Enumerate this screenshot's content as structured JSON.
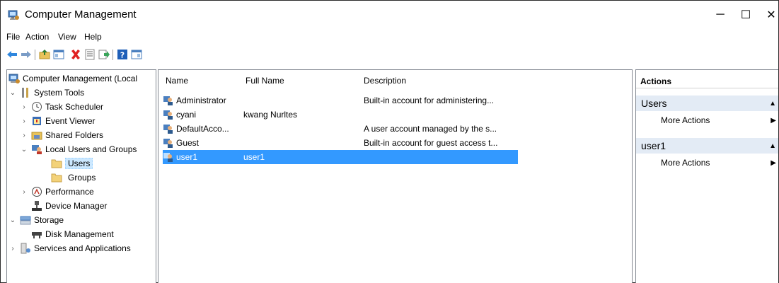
{
  "window": {
    "title": "Computer Management",
    "controls": {
      "minimize": "─",
      "maximize": "☐",
      "close": "✕"
    }
  },
  "menu": [
    "File",
    "Action",
    "View",
    "Help"
  ],
  "toolbar": {
    "buttons": [
      "back-arrow-icon",
      "forward-arrow-icon",
      "up-folder-icon",
      "show-hide-tree-icon",
      "delete-icon",
      "properties-icon",
      "export-list-icon",
      "help-icon",
      "show-hide-action-pane-icon"
    ]
  },
  "tree": {
    "root": "Computer Management (Local",
    "system_tools": "System Tools",
    "task_scheduler": "Task Scheduler",
    "event_viewer": "Event Viewer",
    "shared_folders": "Shared Folders",
    "local_users_groups": "Local Users and Groups",
    "users": "Users",
    "groups": "Groups",
    "performance": "Performance",
    "device_manager": "Device Manager",
    "storage": "Storage",
    "disk_management": "Disk Management",
    "services_apps": "Services and Applications"
  },
  "list": {
    "columns": {
      "name": "Name",
      "full_name": "Full Name",
      "description": "Description"
    },
    "rows": [
      {
        "name": "Administrator",
        "full_name": "",
        "description": "Built-in account for administering..."
      },
      {
        "name": "cyani",
        "full_name": "kwang Nurltes",
        "description": ""
      },
      {
        "name": "DefaultAcco...",
        "full_name": "",
        "description": "A user account managed by the s..."
      },
      {
        "name": "Guest",
        "full_name": "",
        "description": "Built-in account for guest access t..."
      },
      {
        "name": "user1",
        "full_name": "user1",
        "description": ""
      }
    ],
    "selected_row": "user1"
  },
  "actions": {
    "header": "Actions",
    "sections": [
      {
        "title": "Users",
        "item": "More Actions"
      },
      {
        "title": "user1",
        "item": "More Actions"
      }
    ]
  },
  "colors": {
    "selection": "#3399ff",
    "section_bg": "#e3ebf5",
    "tree_selection": "#cce8ff"
  }
}
